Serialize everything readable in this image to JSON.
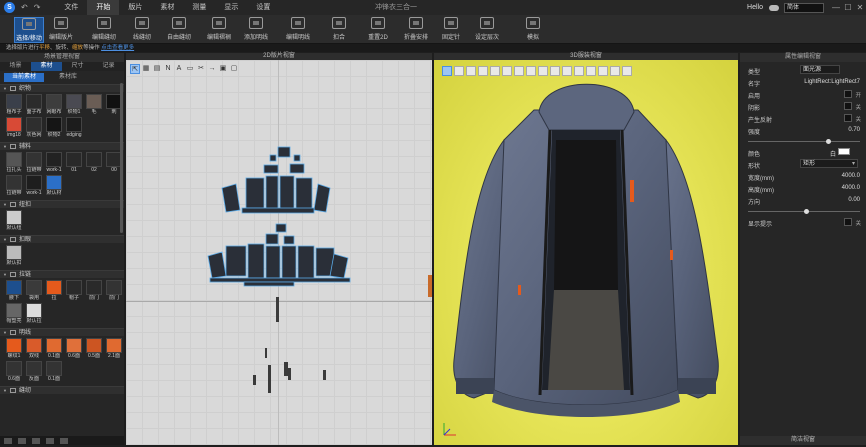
{
  "titlebar": {
    "logo": "S",
    "undo": "↶",
    "redo": "↷",
    "menu": [
      "文件",
      "开始",
      "版片",
      "素材",
      "测量",
      "显示",
      "设置"
    ],
    "active_menu_index": 1,
    "title": "冲锋衣三合一",
    "hello": "Hello",
    "cloud_icon": "cloud-icon",
    "language": "简体",
    "minimize": "—",
    "maximize": "☐",
    "close": "✕"
  },
  "toolbar": {
    "tools": [
      {
        "label": "选择/移动",
        "icon": "select-arrow-icon",
        "selected": true
      },
      {
        "label": "编辑版片",
        "icon": "edit-pattern-icon"
      },
      {
        "label": "编辑缝纫",
        "icon": "edit-sewing-icon"
      },
      {
        "label": "线缝纫",
        "icon": "segment-sewing-icon"
      },
      {
        "label": "自由缝纫",
        "icon": "free-sewing-icon"
      },
      {
        "label": "编辑褶裥",
        "icon": "edit-pleat-icon"
      },
      {
        "label": "添加明线",
        "icon": "add-topstitch-icon"
      },
      {
        "label": "编辑明线",
        "icon": "edit-topstitch-icon"
      },
      {
        "label": "扣合",
        "icon": "button-icon"
      },
      {
        "label": "重置2D",
        "icon": "reset-2d-icon"
      },
      {
        "label": "折叠安排",
        "icon": "fold-arrange-icon"
      },
      {
        "label": "固定针",
        "icon": "pin-icon"
      },
      {
        "label": "设定层次",
        "icon": "layer-icon"
      },
      {
        "label": "模拟",
        "icon": "simulate-icon"
      }
    ]
  },
  "hint": {
    "prefix": "选择版片进行",
    "highlight1": "平移",
    "mid": "、旋转、",
    "highlight2": "缩放",
    "suffix": "等操作",
    "link": "点击查看更多"
  },
  "left_panel": {
    "title": "场景管理视窗",
    "tabs": [
      "场景",
      "素材",
      "尺寸",
      "记录"
    ],
    "active_tab_index": 1,
    "subtabs": [
      "当前素材",
      "素材库"
    ],
    "active_subtab_index": 0,
    "sections": [
      {
        "name": "织物",
        "items": [
          {
            "label": "粗布子",
            "color": "#3a3f4a"
          },
          {
            "label": "面子布",
            "color": "#2b2b2b"
          },
          {
            "label": "网眼布",
            "color": "#3d3d3d"
          },
          {
            "label": "织物1",
            "color": "#4a4a52"
          },
          {
            "label": "毛",
            "color": "#6a5d55"
          },
          {
            "label": "刺",
            "color": "#111111"
          },
          {
            "label": "img18",
            "color": "#d84a36"
          },
          {
            "label": "灰色网",
            "color": "#2e2e2e"
          },
          {
            "label": "织物2",
            "color": "#151515"
          },
          {
            "label": "edging",
            "color": "#1c1c1c"
          }
        ]
      },
      {
        "name": "辅料",
        "items": [
          {
            "label": "拉扎头",
            "color": "#555555"
          },
          {
            "label": "拉链带",
            "color": "#333333"
          },
          {
            "label": "work-1",
            "color": "#222222"
          },
          {
            "label": "01",
            "color": "#292929"
          },
          {
            "label": "02",
            "color": "#292929"
          },
          {
            "label": "00",
            "color": "#2a2a2a"
          },
          {
            "label": "拉链带",
            "color": "#333333"
          },
          {
            "label": "work-1",
            "color": "#1e1e1e"
          },
          {
            "label": "默认材",
            "color": "#2b6fc7"
          }
        ]
      },
      {
        "name": "纽扣",
        "items": [
          {
            "label": "默认纽",
            "color": "#cccccc"
          }
        ]
      },
      {
        "name": "扣眼",
        "items": [
          {
            "label": "默认扣",
            "color": "#bbbbbb"
          }
        ]
      },
      {
        "name": "拉链",
        "items": [
          {
            "label": "腋下",
            "color": "#1d4f8e"
          },
          {
            "label": "袋用",
            "color": "#3a3a3a"
          },
          {
            "label": "拉",
            "color": "#e55a1c"
          },
          {
            "label": "帽子",
            "color": "#2a2a2a"
          },
          {
            "label": "前门",
            "color": "#2a2a2a"
          },
          {
            "label": "前门",
            "color": "#333333"
          },
          {
            "label": "帽塑亮",
            "color": "#666666"
          },
          {
            "label": "默认拉",
            "color": "#dddddd"
          }
        ]
      },
      {
        "name": "明线",
        "items": [
          {
            "label": "螺纹1",
            "color": "#e55a1c"
          },
          {
            "label": "双线",
            "color": "#d95b2a"
          },
          {
            "label": "0.1面",
            "color": "#e06a30"
          },
          {
            "label": "0.6面",
            "color": "#e0703a"
          },
          {
            "label": "0.5面",
            "color": "#cc5522"
          },
          {
            "label": "2.1面",
            "color": "#e06a30"
          },
          {
            "label": "0.6面",
            "color": "#333333"
          },
          {
            "label": "反面",
            "color": "#333333"
          },
          {
            "label": "0.1面",
            "color": "#333333"
          }
        ]
      },
      {
        "name": "缝纫",
        "items": []
      }
    ]
  },
  "view2d": {
    "title": "2D版片视窗",
    "tools": [
      "⇱",
      "▦",
      "▤",
      "N",
      "A",
      "▭",
      "✂",
      "→",
      "▣",
      "▢"
    ]
  },
  "view3d": {
    "title": "3D服装视窗",
    "tool_count": 16
  },
  "right_panel": {
    "title": "属性编辑视窗",
    "props": [
      {
        "key": "类型",
        "box": "面光源"
      },
      {
        "key": "名字",
        "value": "LightRect:LightRect7"
      },
      {
        "key": "启用",
        "check_label": "开"
      },
      {
        "key": "阴影",
        "check_label": "关"
      },
      {
        "key": "产生反射",
        "check_label": "关"
      },
      {
        "key": "强度",
        "value": "0.70",
        "slider": 0.7
      },
      {
        "key": "颜色",
        "color_label": "白",
        "color": "#ffffff"
      },
      {
        "key": "形状",
        "select": "矩形"
      },
      {
        "key": "宽度(mm)",
        "value": "4000.0"
      },
      {
        "key": "高度(mm)",
        "value": "4000.0"
      },
      {
        "key": "方向",
        "value": "0.00",
        "slider": 0.5
      },
      {
        "key": "显示提示",
        "check_label": "关"
      }
    ],
    "bottom": "简洁视窗"
  }
}
